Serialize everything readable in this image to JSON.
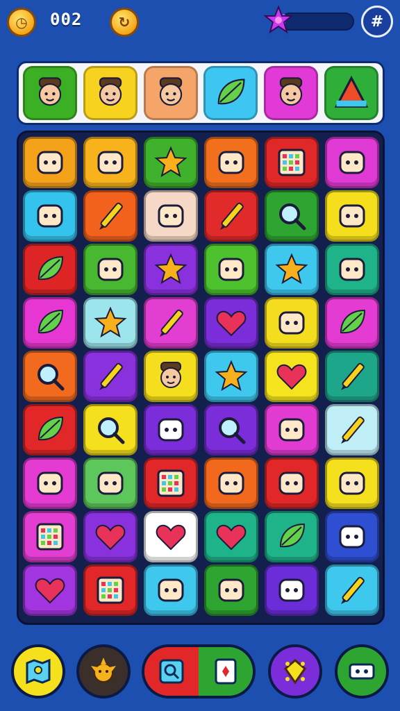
{
  "hud": {
    "score": "002",
    "coin_left_icon": "clock-coin-icon",
    "coin_right_icon": "refresh-coin-icon",
    "progress": 0.05,
    "star_color": "#c43cf0",
    "menu_icon": "grid-menu-icon"
  },
  "characters": [
    {
      "icon": "hunter-face-icon",
      "color": "#3cb024"
    },
    {
      "icon": "hat-girl-face-icon",
      "color": "#f7d21e"
    },
    {
      "icon": "viking-face-icon",
      "color": "#f5a56a"
    },
    {
      "icon": "leaf-cone-icon",
      "color": "#3ec6f2"
    },
    {
      "icon": "witch-face-icon",
      "color": "#e23ad6"
    },
    {
      "icon": "triangle-flag-icon",
      "color": "#2fae3a"
    }
  ],
  "board": {
    "rows": [
      [
        {
          "icon": "creature-icon",
          "color": "#f5a21b"
        },
        {
          "icon": "briefcase-icon",
          "color": "#f7b21c"
        },
        {
          "icon": "wand-star-icon",
          "color": "#3fb12d"
        },
        {
          "icon": "robot-icon",
          "color": "#f26f1e"
        },
        {
          "icon": "radio-icon",
          "color": "#e12828"
        },
        {
          "icon": "pocket-icon",
          "color": "#e03ad4"
        }
      ],
      [
        {
          "icon": "dotted-ball-icon",
          "color": "#33c3ec"
        },
        {
          "icon": "hammer-icon",
          "color": "#f2621d"
        },
        {
          "icon": "compass-icon",
          "color": "#f6d8c6"
        },
        {
          "icon": "crossed-tools-icon",
          "color": "#e12a2a"
        },
        {
          "icon": "magnifier-icon",
          "color": "#2fa531"
        },
        {
          "icon": "shield-gem-icon",
          "color": "#f5df1c"
        }
      ],
      [
        {
          "icon": "bird-icon",
          "color": "#de2525"
        },
        {
          "icon": "bottle-icon",
          "color": "#47b82f"
        },
        {
          "icon": "fish-star-icon",
          "color": "#8a31de"
        },
        {
          "icon": "balloon-icon",
          "color": "#4ec12f"
        },
        {
          "icon": "star-icon",
          "color": "#3ec8ee"
        },
        {
          "icon": "bell-icon",
          "color": "#1fb38a"
        }
      ],
      [
        {
          "icon": "eggplant-icon",
          "color": "#e637d2"
        },
        {
          "icon": "splat-star-icon",
          "color": "#9ce5ec"
        },
        {
          "icon": "magic-wand-icon",
          "color": "#e23ed2"
        },
        {
          "icon": "heart-icon",
          "color": "#7a2dd8"
        },
        {
          "icon": "card-icon",
          "color": "#f4dd1e"
        },
        {
          "icon": "leaf-icon",
          "color": "#e43bd3"
        }
      ],
      [
        {
          "icon": "target-icon",
          "color": "#f26a1d"
        },
        {
          "icon": "crossed-pencils-icon",
          "color": "#8a31de"
        },
        {
          "icon": "hat-face-icon",
          "color": "#f5de1d"
        },
        {
          "icon": "star-icon",
          "color": "#3ec8ee"
        },
        {
          "icon": "heart-icon",
          "color": "#f5e31d"
        },
        {
          "icon": "pencil-icon",
          "color": "#1ea68b"
        }
      ],
      [
        {
          "icon": "duck-icon",
          "color": "#e12727"
        },
        {
          "icon": "magnifier-icon",
          "color": "#f5e01d"
        },
        {
          "icon": "onion-icon",
          "color": "#7a2dd8"
        },
        {
          "icon": "ring-icon",
          "color": "#7a2dd8"
        },
        {
          "icon": "vault-icon",
          "color": "#e13bd2"
        },
        {
          "icon": "pencil-icon",
          "color": "#bfeef7"
        }
      ],
      [
        {
          "icon": "sun-badge-icon",
          "color": "#e43bd3"
        },
        {
          "icon": "can-icon",
          "color": "#5ec75c"
        },
        {
          "icon": "calendar-grid-icon",
          "color": "#e12727"
        },
        {
          "icon": "crown-icon",
          "color": "#f2691d"
        },
        {
          "icon": "safe-icon",
          "color": "#e12727"
        },
        {
          "icon": "basket-icon",
          "color": "#f5e01d"
        }
      ],
      [
        {
          "icon": "keypad-icon",
          "color": "#e23ed2"
        },
        {
          "icon": "heart-icon",
          "color": "#8a31de"
        },
        {
          "icon": "heart-icon",
          "color": "#ffffff"
        },
        {
          "icon": "heart-icon",
          "color": "#1fb38a"
        },
        {
          "icon": "leaf-icon",
          "color": "#1fb38a"
        },
        {
          "icon": "bow-icon",
          "color": "#2e4fd2"
        }
      ],
      [
        {
          "icon": "heart-icon",
          "color": "#a335e0"
        },
        {
          "icon": "notepad-icon",
          "color": "#e12727"
        },
        {
          "icon": "potato-icon",
          "color": "#3ec8ee"
        },
        {
          "icon": "shield-icon",
          "color": "#2fa531"
        },
        {
          "icon": "monster-icon",
          "color": "#6a2dd8"
        },
        {
          "icon": "arrowhead-icon",
          "color": "#3ec8ee"
        }
      ]
    ]
  },
  "bottom": {
    "map_icon": "map-icon",
    "map_color": "#f5e01d",
    "creature_icon": "sun-creature-icon",
    "creature_color": "#3a2f2a",
    "split_left_icon": "magnifier-icon",
    "split_left_color": "#e12727",
    "split_right_icon": "card-icon",
    "split_right_color": "#2fa531",
    "gem_icon": "gem-icon",
    "gem_color": "#7a2dd8",
    "ticket_icon": "ticket-icon",
    "ticket_color": "#2fa531"
  }
}
